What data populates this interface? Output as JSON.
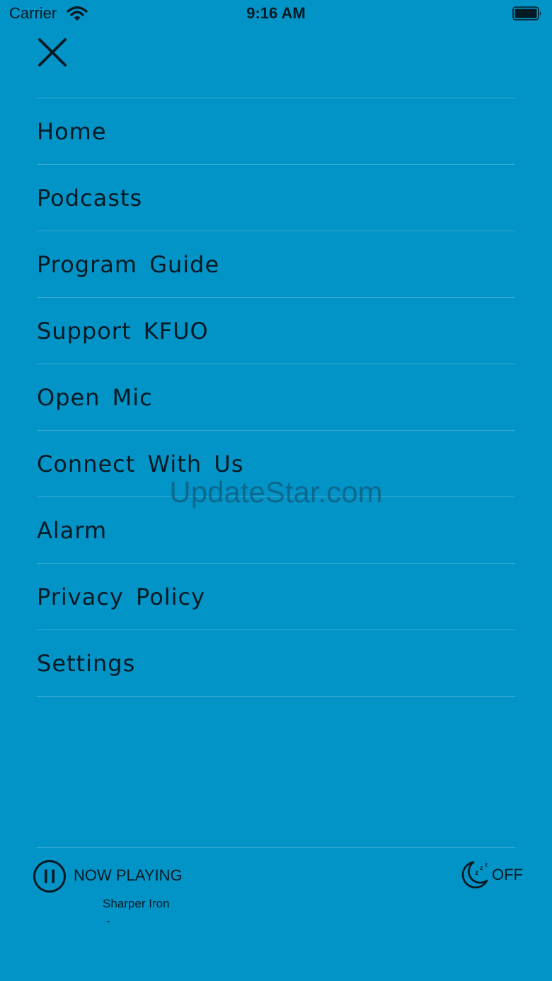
{
  "status_bar": {
    "carrier": "Carrier",
    "time": "9:16 AM",
    "wifi_icon": "wifi-icon",
    "battery_icon": "battery-full-icon"
  },
  "header": {
    "close_icon": "close-icon"
  },
  "menu": {
    "items": [
      {
        "label": "Home",
        "name": "home"
      },
      {
        "label": "Podcasts",
        "name": "podcasts"
      },
      {
        "label": "Program Guide",
        "name": "program-guide"
      },
      {
        "label": "Support KFUO",
        "name": "support-kfuo"
      },
      {
        "label": "Open Mic",
        "name": "open-mic"
      },
      {
        "label": "Connect With Us",
        "name": "connect-with-us"
      },
      {
        "label": "Alarm",
        "name": "alarm"
      },
      {
        "label": "Privacy Policy",
        "name": "privacy-policy"
      },
      {
        "label": "Settings",
        "name": "settings"
      }
    ]
  },
  "watermark": "UpdateStar.com",
  "player": {
    "now_playing_label": "NOW PLAYING",
    "track_title": "Sharper Iron",
    "track_artist": "-",
    "play_state_icon": "pause-icon",
    "sleep_icon": "sleep-timer-moon-icon",
    "sleep_timer_label": "OFF"
  },
  "colors": {
    "background": "#0394c7",
    "foreground": "#061a24",
    "divider": "rgba(255,255,255,0.22)"
  }
}
